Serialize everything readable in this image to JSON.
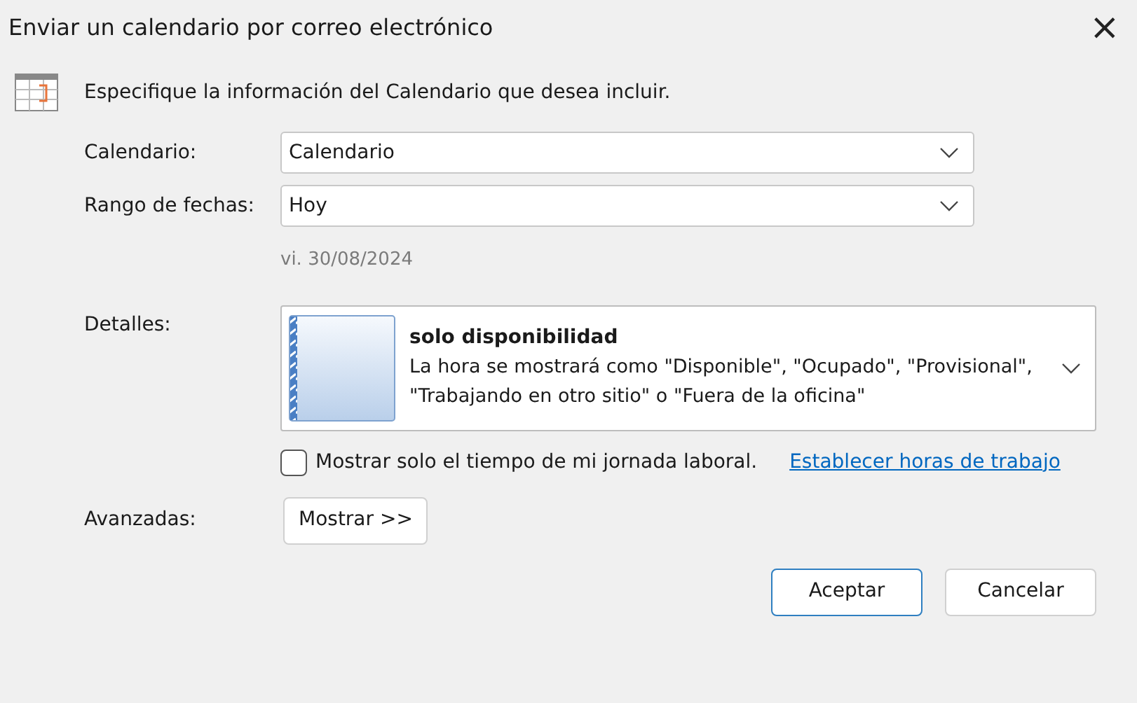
{
  "window": {
    "title": "Enviar un calendario por correo electrónico",
    "close": "×"
  },
  "intro": "Especifique la información del Calendario que desea incluir.",
  "fields": [
    {
      "label": "Calendario:",
      "value": "Calendario"
    },
    {
      "label": "Rango de fechas:",
      "value": "Hoy"
    }
  ],
  "date_hint": "vi. 30/08/2024",
  "details": {
    "label": "Detalles:",
    "title": "solo disponibilidad",
    "description": "La hora se mostrará como \"Disponible\", \"Ocupado\", \"Provisional\", \"Trabajando en otro sitio\" o \"Fuera de la oficina\""
  },
  "working_hours": {
    "label": "Mostrar solo el tiempo de mi jornada laboral.",
    "checked": false,
    "link": "Establecer horas de trabajo"
  },
  "advanced": {
    "label": "Avanzadas:",
    "button": "Mostrar >>"
  },
  "buttons": [
    {
      "label": "Aceptar",
      "default": true
    },
    {
      "label": "Cancelar",
      "default": false
    }
  ]
}
